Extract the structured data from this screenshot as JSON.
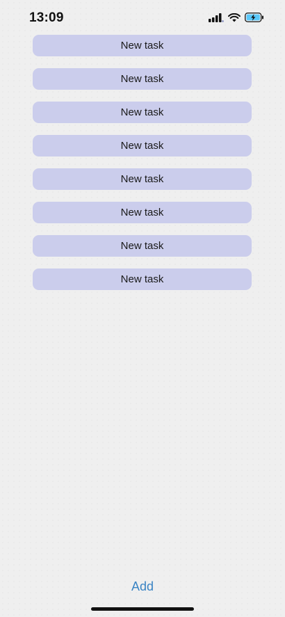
{
  "status_bar": {
    "time": "13:09",
    "icons": [
      "cellular-signal-icon",
      "wifi-icon",
      "battery-charging-icon"
    ]
  },
  "tasks": [
    {
      "label": "New task"
    },
    {
      "label": "New task"
    },
    {
      "label": "New task"
    },
    {
      "label": "New task"
    },
    {
      "label": "New task"
    },
    {
      "label": "New task"
    },
    {
      "label": "New task"
    },
    {
      "label": "New task"
    }
  ],
  "toolbar": {
    "add_label": "Add"
  },
  "colors": {
    "task_background": "#cbcdec",
    "accent": "#3a84c4",
    "battery_fill": "#5ac8fa"
  }
}
